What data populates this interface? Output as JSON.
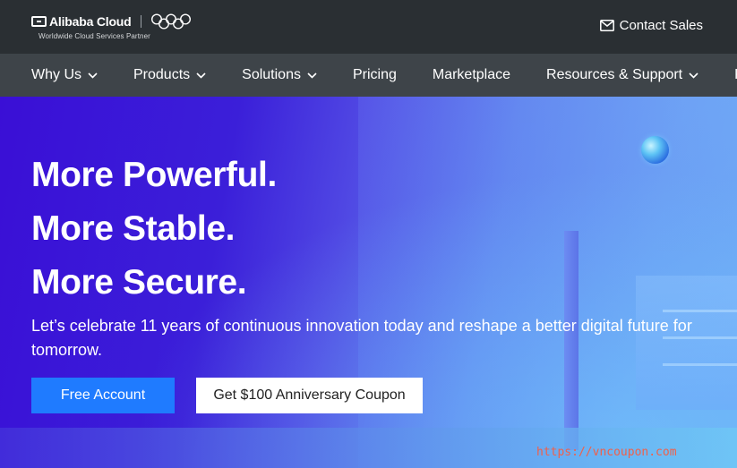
{
  "brand": {
    "name": "Alibaba Cloud",
    "tagline": "Worldwide Cloud Services Partner"
  },
  "header": {
    "contact_label": "Contact Sales"
  },
  "nav": {
    "items": [
      {
        "label": "Why Us",
        "dropdown": true
      },
      {
        "label": "Products",
        "dropdown": true
      },
      {
        "label": "Solutions",
        "dropdown": true
      },
      {
        "label": "Pricing",
        "dropdown": false
      },
      {
        "label": "Marketplace",
        "dropdown": false
      },
      {
        "label": "Resources & Support",
        "dropdown": true
      },
      {
        "label": "P",
        "dropdown": false
      }
    ]
  },
  "hero": {
    "headline_1": "More Powerful.",
    "headline_2": "More Stable.",
    "headline_3": "More Secure.",
    "subtext": "Let’s celebrate 11 years of continuous innovation today and reshape a better digital future for tomorrow.",
    "primary_button": "Free Account",
    "secondary_button": "Get $100 Anniversary Coupon"
  },
  "watermark": "https://vncoupon.com",
  "colors": {
    "topbar": "#2a2f33",
    "navbar": "#3e4449",
    "primary_button": "#1f7bff",
    "hero_start": "#3a0fd6",
    "hero_end": "#6dacf4"
  },
  "icons": {
    "contact": "mail-icon",
    "dropdown": "chevron-down-icon",
    "olympic": "olympic-rings-icon"
  }
}
